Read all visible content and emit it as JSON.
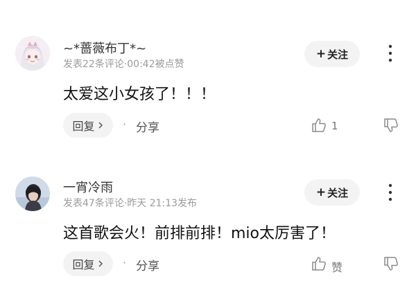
{
  "comments": [
    {
      "username": "~*蔷薇布丁*~",
      "meta": "发表22条评论·00:42被点赞",
      "follow_label": "关注",
      "content": "太爱这小女孩了！！！",
      "reply_label": "回复",
      "share_label": "分享",
      "like_count": "1",
      "avatar_desc": "anime-girl-avatar"
    },
    {
      "username": "一宵冷雨",
      "meta": "发表47条评论·昨天 21:13发布",
      "follow_label": "关注",
      "content": "这首歌会火！前排前排！mio太厉害了！",
      "reply_label": "回复",
      "share_label": "分享",
      "like_count": "赞",
      "avatar_desc": "photo-avatar"
    }
  ],
  "colors": {
    "button_bg": "#f3f3f3",
    "meta_text": "#9a9a9a",
    "icon_gray": "#8a8a8a"
  }
}
